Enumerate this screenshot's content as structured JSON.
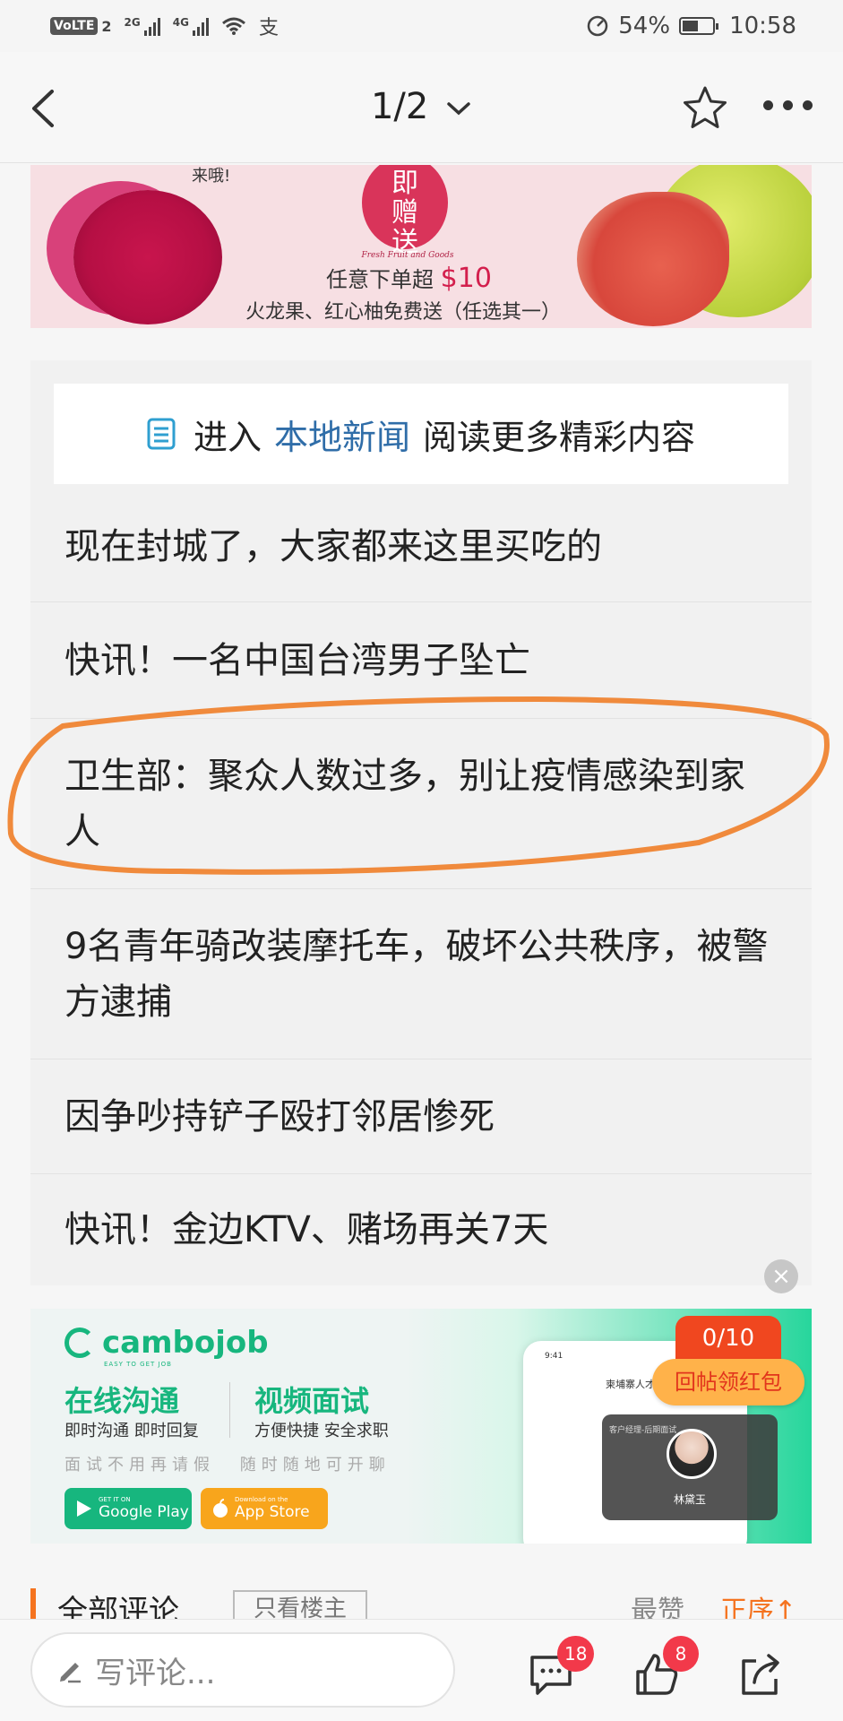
{
  "status_bar": {
    "volte": "VoLTE",
    "sim": "2",
    "net1": "2G",
    "net2": "4G",
    "extra_icon": "支",
    "battery_percent": "54%",
    "battery_level": 0.54,
    "time": "10:58"
  },
  "nav": {
    "page_indicator": "1/2"
  },
  "top_banner": {
    "seal_text": "即\n赠\n送",
    "subtitle": "Fresh Fruit and Goods",
    "offer_prefix": "任意下单超",
    "offer_amount": "$10",
    "offer_line": "火龙果、红心柚免费送（任选其一）",
    "corner_text": "来哦!"
  },
  "promo": {
    "prefix": "进入",
    "link": "本地新闻",
    "suffix": "阅读更多精彩内容"
  },
  "news": [
    "现在封城了，大家都来这里买吃的",
    "快讯！一名中国台湾男子坠亡",
    "卫生部：聚众人数过多，别让疫情感染到家人",
    "9名青年骑改装摩托车，破坏公共秩序，被警方逮捕",
    "因争吵持铲子殴打邻居惨死",
    "快讯！金边KTV、赌场再关7天"
  ],
  "close_symbol": "×",
  "ad": {
    "brand": "cambojob",
    "tagline": "EASY TO GET JOB",
    "headline1": "在线沟通",
    "sub1": "即时沟通 即时回复",
    "headline2": "视频面试",
    "sub2": "方便快捷 安全求职",
    "faint1": "面试不用再请假",
    "faint2": "随时随地可开聊",
    "google_small": "GET IT ON",
    "google_label": "Google Play",
    "apple_small": "Download on the",
    "apple_label": "App Store",
    "phone_time": "9:41",
    "phone_title": "柬埔寨人才网",
    "video_tag": "客户经理-后期面试",
    "video_name": "林黛玉",
    "counter": "0/10",
    "reward": "回帖领红包"
  },
  "comments_header": {
    "title": "全部评论",
    "filter": "只看楼主",
    "sort_label": "最赞",
    "order_label": "正序↑"
  },
  "bottom_bar": {
    "comment_placeholder": "写评论...",
    "comment_count": "18",
    "like_count": "8"
  },
  "colors": {
    "accent_orange": "#f5731f",
    "link_blue": "#2f6da8",
    "badge_red": "#f2394a",
    "brand_green": "#17b67e"
  }
}
